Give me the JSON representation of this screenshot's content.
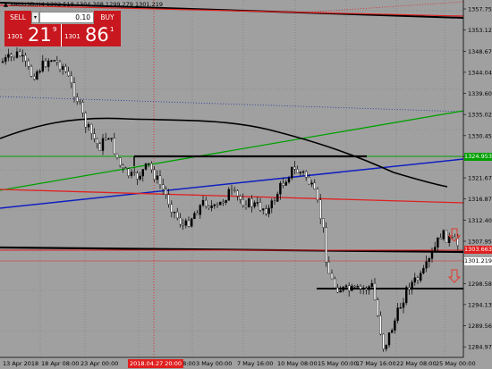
{
  "title_bar": "▲ XAUUSD,H4  1302.518 1304.208 1299.279 1301.219",
  "trade_panel": {
    "sell_label": "SELL",
    "buy_label": "BUY",
    "lot_value": "0.10",
    "lot_arrow": "▾",
    "sell_price": {
      "small": "1301",
      "big": "21",
      "sup": "9"
    },
    "buy_price": {
      "small": "1301",
      "big": "86",
      "sup": "1"
    }
  },
  "price_axis": [
    "1357.75",
    "1353.125",
    "1348.670",
    "1344.045",
    "1339.605",
    "1335.025",
    "1330.450",
    "1326.885",
    "1321.675",
    "1316.875",
    "1312.405",
    "1307.955",
    "1303.360",
    "1298.585",
    "1294.130",
    "1289.565",
    "1284.970"
  ],
  "price_tags": {
    "green_level": "1324.953",
    "red_level": "1303.663",
    "current": "1301.219"
  },
  "time_axis": [
    "13 Apr 2018",
    "18 Apr 08:00",
    "23 Apr 00:00",
    "08:00",
    "3 May 00:00",
    "7 May 16:00",
    "10 May 08:00",
    "15 May 00:00",
    "17 May 16:00",
    "22 May 08:00",
    "25 May 00:00"
  ],
  "highlighted_time": "2018.04.27 20:00",
  "colors": {
    "background": "#a0a0a0",
    "bull": "#000000",
    "bear": "#ffffff",
    "sell": "#c8171e",
    "down_arrow": "#e23a2a"
  },
  "icons": [
    "down-arrow-icon"
  ]
}
